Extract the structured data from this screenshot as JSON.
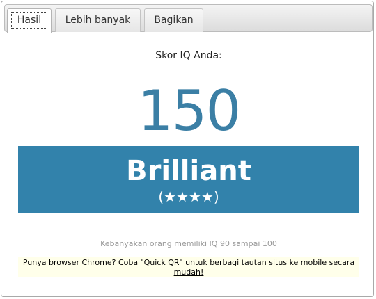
{
  "tabs": [
    {
      "label": "Hasil",
      "active": true
    },
    {
      "label": "Lebih banyak",
      "active": false
    },
    {
      "label": "Bagikan",
      "active": false
    }
  ],
  "result": {
    "score_label": "Skor IQ Anda:",
    "score": "150",
    "rating": "Brilliant",
    "stars": "(★★★★)"
  },
  "note": "Kebanyakan orang memiliki IQ 90 sampai 100",
  "promo": {
    "link_text": "Punya browser Chrome? Coba \"Quick QR\" untuk berbagi tautan situs ke mobile secara mudah!"
  },
  "colors": {
    "accent": "#3282ab",
    "score_text": "#3b7fa5",
    "promo_bg": "#ffffea"
  }
}
